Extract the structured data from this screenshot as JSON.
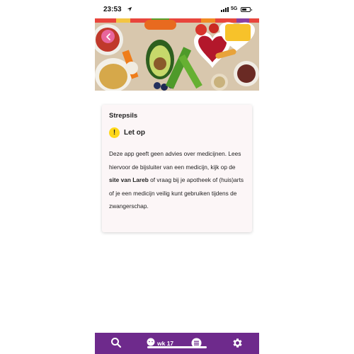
{
  "status_bar": {
    "time": "23:53",
    "network": "5G"
  },
  "hero": {
    "image": "healthy-food-colorful-bowls"
  },
  "card": {
    "title": "Strepsils",
    "warning_label": "Let op",
    "text_before_link": "Deze app geeft geen advies over medicijnen. Lees hiervoor de bijsluiter van een medicijn, kijk op de ",
    "link_text": "site van Lareb",
    "text_after_link": " of vraag bij je apotheek of (huis)arts of je een medicijn veilig kunt gebruiken tijdens de zwangerschap."
  },
  "bottom_nav": {
    "week_label": "wk 17",
    "icons": [
      "search-icon",
      "baby-icon",
      "list-icon",
      "gear-icon"
    ]
  },
  "colors": {
    "accent": "#6e2a8c",
    "back_button": "#e8659c",
    "warning": "#ffd81a",
    "card_bg": "#fcf6f7"
  }
}
